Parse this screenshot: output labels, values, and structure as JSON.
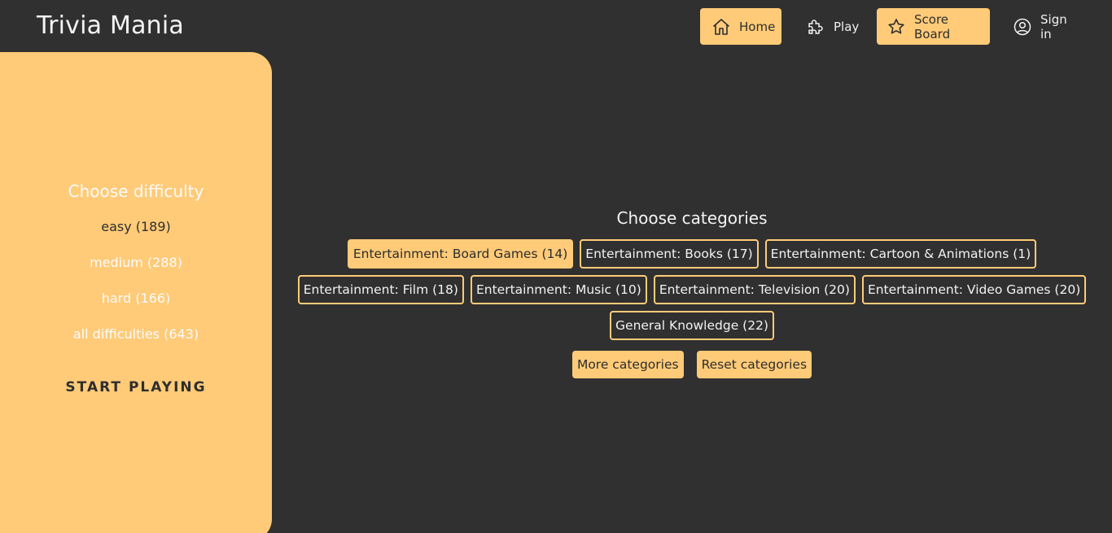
{
  "app": {
    "title": "Trivia Mania"
  },
  "nav": {
    "home": "Home",
    "play": "Play",
    "score_board": "Score Board",
    "sign_in": "Sign in"
  },
  "sidebar": {
    "title": "Choose difficulty",
    "difficulties": [
      {
        "label": "easy (189)",
        "selected": true
      },
      {
        "label": "medium (288)",
        "selected": false
      },
      {
        "label": "hard (166)",
        "selected": false
      },
      {
        "label": "all difficulties (643)",
        "selected": false
      }
    ],
    "start_label": "START PLAYING"
  },
  "categories": {
    "title": "Choose categories",
    "rows": [
      [
        {
          "label": "Entertainment: Board Games (14)",
          "selected": true
        },
        {
          "label": "Entertainment: Books (17)",
          "selected": false
        },
        {
          "label": "Entertainment: Cartoon & Animations (1)",
          "selected": false
        }
      ],
      [
        {
          "label": "Entertainment: Film (18)",
          "selected": false
        },
        {
          "label": "Entertainment: Music (10)",
          "selected": false
        },
        {
          "label": "Entertainment: Television (20)",
          "selected": false
        },
        {
          "label": "Entertainment: Video Games (20)",
          "selected": false
        }
      ],
      [
        {
          "label": "General Knowledge (22)",
          "selected": false
        }
      ]
    ],
    "more_label": "More categories",
    "reset_label": "Reset categories"
  },
  "colors": {
    "background": "#303030",
    "accent": "#ffcb78",
    "text_light": "#f2f2f2",
    "text_dark": "#2d2d2d"
  }
}
